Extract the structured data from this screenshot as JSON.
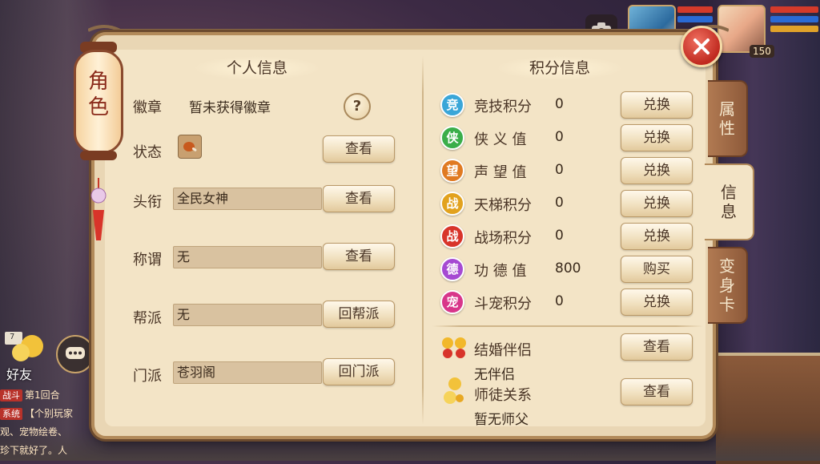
{
  "hud": {
    "level": "150"
  },
  "lantern": {
    "title_char1": "角",
    "title_char2": "色"
  },
  "left_hud": {
    "friend_label": "好友",
    "friend_badge": "7",
    "log": [
      {
        "tag": "战斗",
        "tag_color": "#b8322a",
        "text": "第1回合"
      },
      {
        "tag": "系统",
        "tag_color": "#b8322a",
        "text": "【个别玩家"
      },
      {
        "tag": "",
        "tag_color": "",
        "text": "观、宠物绘卷、"
      },
      {
        "tag": "",
        "tag_color": "",
        "text": "珍下就好了。人"
      }
    ]
  },
  "personal_info": {
    "title": "个人信息",
    "badge_label": "徽章",
    "badge_value": "暂未获得徽章",
    "help_symbol": "?",
    "status_label": "状态",
    "status_button": "查看",
    "rank_label": "头衔",
    "rank_value": "全民女神",
    "rank_button": "查看",
    "title_label": "称谓",
    "title_value": "无",
    "title_button": "查看",
    "guild_label": "帮派",
    "guild_value": "无",
    "guild_button": "回帮派",
    "sect_label": "门派",
    "sect_value": "苍羽阁",
    "sect_button": "回门派"
  },
  "points_info": {
    "title": "积分信息",
    "rows": [
      {
        "icon_char": "竞",
        "icon_color": "#3aa6d8",
        "name": "竞技积分",
        "value": "0",
        "button": "兑换"
      },
      {
        "icon_char": "侠",
        "icon_color": "#3aae4a",
        "name": "侠 义 值",
        "value": "0",
        "button": "兑换"
      },
      {
        "icon_char": "望",
        "icon_color": "#e07a22",
        "name": "声 望 值",
        "value": "0",
        "button": "兑换"
      },
      {
        "icon_char": "战",
        "icon_color": "#e2a21e",
        "name": "天梯积分",
        "value": "0",
        "button": "兑换"
      },
      {
        "icon_char": "战",
        "icon_color": "#d8342a",
        "name": "战场积分",
        "value": "0",
        "button": "兑换"
      },
      {
        "icon_char": "德",
        "icon_color": "#a64ad2",
        "name": "功 德 值",
        "value": "800",
        "button": "购买"
      },
      {
        "icon_char": "宠",
        "icon_color": "#d8368a",
        "name": "斗宠积分",
        "value": "0",
        "button": "兑换"
      }
    ],
    "marriage_label": "结婚伴侣",
    "marriage_value": "无伴侣",
    "marriage_button": "查看",
    "mentor_label": "师徒关系",
    "mentor_value": "暂无师父",
    "mentor_button": "查看"
  },
  "side_tabs": [
    {
      "label": "属性",
      "active": false
    },
    {
      "label": "信息",
      "active": true
    },
    {
      "label": "变身卡",
      "active": false
    }
  ]
}
